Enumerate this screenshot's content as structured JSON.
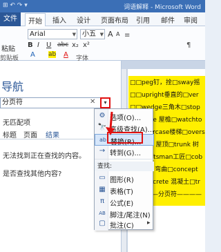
{
  "titlebar": {
    "qa_icons": "⊞ ↶ ↷ ▾",
    "title": "词语解释 - Microsoft Word"
  },
  "tabs": {
    "file": "文件",
    "items": [
      "开始",
      "插入",
      "设计",
      "页面布局",
      "引用",
      "邮件",
      "审阅"
    ]
  },
  "ribbon": {
    "font_name": "Arial",
    "font_size": "小五",
    "grow": "A",
    "shrink": "A",
    "paste": "粘贴",
    "bold": "B",
    "italic": "I",
    "underline": "U",
    "strike": "abc",
    "sub": "x₂",
    "sup": "x²",
    "font_color": "A",
    "highlight": "ab",
    "shade": "A",
    "font_group": "字体",
    "clipboard_group": "剪贴板",
    "para_hint": "≡",
    "marks": [
      "↵",
      "¶"
    ]
  },
  "nav": {
    "title": "导航",
    "search_value": "分页符",
    "close": "✕",
    "dropdown": "▾",
    "no_match": "无匹配项",
    "tabs": [
      "标题",
      "页面",
      "结果"
    ],
    "msg1": "无法找到正在查找的内容。",
    "msg2": "是否查找其他内容?"
  },
  "menu": {
    "items": [
      {
        "icon": "⚙",
        "label": "选项(O)..."
      },
      {
        "icon": "🔭",
        "label": "高级查找(A)..."
      },
      {
        "icon": "ab",
        "label": "替换(R)..."
      },
      {
        "icon": "→",
        "label": "转到(G)..."
      }
    ],
    "section": "查找:",
    "find_items": [
      {
        "icon": "▭",
        "label": "图形(R)"
      },
      {
        "icon": "▦",
        "label": "表格(T)"
      },
      {
        "icon": "π",
        "label": "公式(E)"
      },
      {
        "icon": "AB",
        "label": "脚注/尾注(N)"
      },
      {
        "icon": "▢",
        "label": "批注(C)"
      }
    ],
    "submenu_arrow": "▸"
  },
  "doc": {
    "lines": [
      "□□peg钉，拴□sway摇",
      "□□upright垂直的□ver",
      "□□wedge三角木□stop",
      "□□eave 屋檐□watchto",
      "□□staircase楼梯□overs",
      "□□roof 屋顶□trunk 树",
      "□□craftsman工匠□cob",
      "□□flex 弯曲□concept",
      "□□concrete 混凝土□tr",
      "————分页符————"
    ]
  },
  "colors": {
    "accent": "#2b5797",
    "highlight": "#ffef00",
    "annotation": "#e01010"
  }
}
